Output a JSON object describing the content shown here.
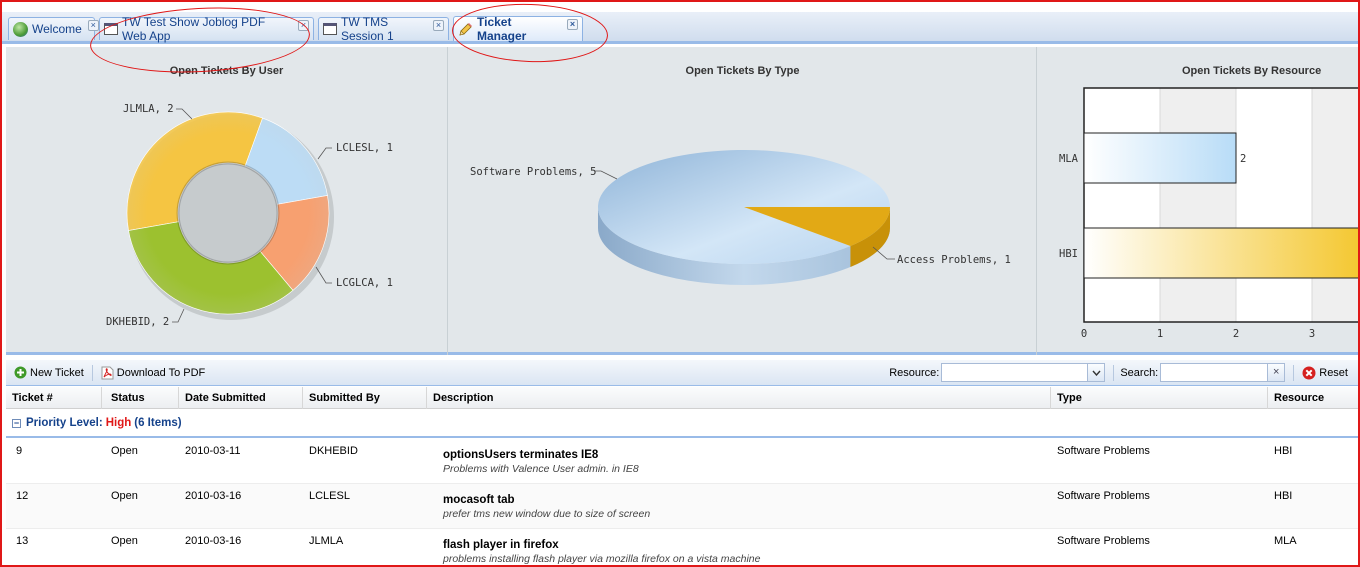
{
  "tabs": [
    {
      "label": "Welcome",
      "icon": "globe-icon"
    },
    {
      "label": "TW Test Show Joblog PDF Web App",
      "icon": "window-icon"
    },
    {
      "label": "TW TMS Session 1",
      "icon": "window-icon"
    },
    {
      "label": "Ticket Manager",
      "icon": "pencil-icon",
      "active": true
    }
  ],
  "tab_close_glyph": "×",
  "charts": {
    "by_user": {
      "title": "Open Tickets By User"
    },
    "by_type": {
      "title": "Open Tickets By Type"
    },
    "by_resource": {
      "title": "Open Tickets By Resource"
    }
  },
  "chart_data": [
    {
      "type": "pie",
      "title": "Open Tickets By User",
      "style": "donut",
      "categories": [
        "JLMLA",
        "LCLESL",
        "LCGLCA",
        "DKHEBID"
      ],
      "values": [
        2,
        1,
        1,
        2
      ],
      "labels": [
        "JLMLA, 2",
        "LCLESL, 1",
        "LCGLCA, 1",
        "DKHEBID, 2"
      ],
      "colors": [
        "#f5c542",
        "#bcdcf5",
        "#f7a070",
        "#9cc12f"
      ]
    },
    {
      "type": "pie",
      "title": "Open Tickets By Type",
      "style": "3d",
      "categories": [
        "Software Problems",
        "Access Problems"
      ],
      "values": [
        5,
        1
      ],
      "labels": [
        "Software Problems, 5",
        "Access Problems, 1"
      ],
      "colors": [
        "#a9c8e6",
        "#e0a916"
      ]
    },
    {
      "type": "bar",
      "orientation": "horizontal",
      "title": "Open Tickets By Resource",
      "categories": [
        "MLA",
        "HBI"
      ],
      "values": [
        2,
        4
      ],
      "data_labels": [
        "2",
        ""
      ],
      "xticks": [
        "0",
        "1",
        "2",
        "3"
      ],
      "xlim": [
        0,
        4
      ],
      "colors": [
        "#b8dcf7",
        "#f3c21c"
      ],
      "grid": true
    }
  ],
  "toolbar": {
    "new_ticket": "New Ticket",
    "download_pdf": "Download To PDF",
    "resource_label": "Resource:",
    "resource_value": "",
    "search_label": "Search:",
    "search_value": "",
    "reset": "Reset"
  },
  "columns": [
    "Ticket #",
    "Status",
    "Date Submitted",
    "Submitted By",
    "Description",
    "Type",
    "Resource"
  ],
  "group": {
    "prefix": "Priority Level:",
    "level": "High",
    "count": "(6 Items)",
    "toggle": "−"
  },
  "rows": [
    {
      "ticket": "9",
      "status": "Open",
      "date": "2010-03-11",
      "by": "DKHEBID",
      "title": "optionsUsers terminates IE8",
      "detail": "Problems with Valence User admin. in IE8",
      "type": "Software Problems",
      "resource": "HBI"
    },
    {
      "ticket": "12",
      "status": "Open",
      "date": "2010-03-16",
      "by": "LCLESL",
      "title": "mocasoft tab",
      "detail": "prefer tms new window due to size of screen",
      "type": "Software Problems",
      "resource": "HBI"
    },
    {
      "ticket": "13",
      "status": "Open",
      "date": "2010-03-16",
      "by": "JLMLA",
      "title": "flash player in firefox",
      "detail": "problems installing flash player via mozilla firefox on a vista machine",
      "type": "Software Problems",
      "resource": "MLA"
    }
  ],
  "colors": {
    "annotation": "#e01818",
    "accent": "#15428b",
    "high": "#e01818"
  }
}
